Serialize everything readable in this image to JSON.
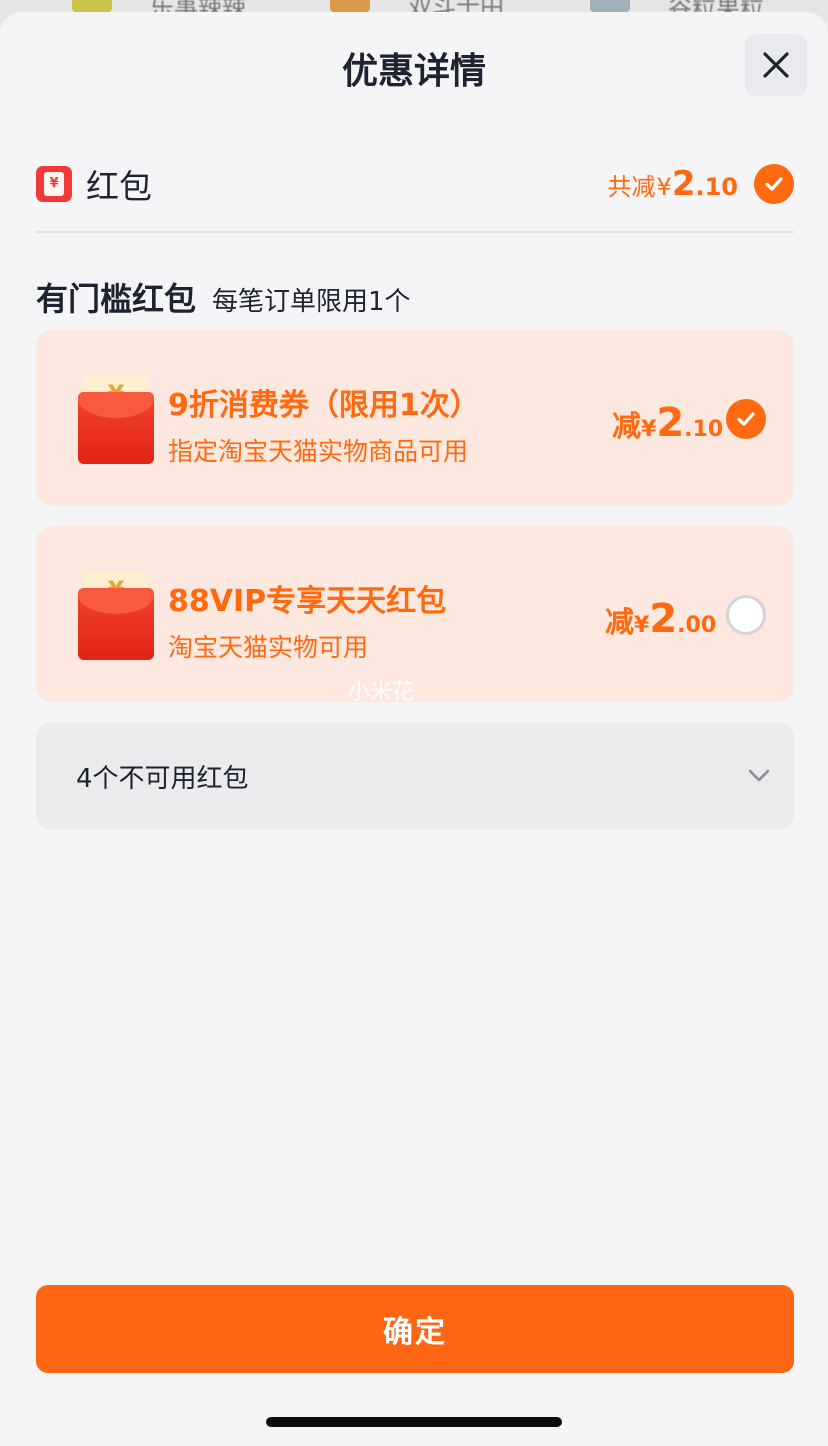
{
  "background": {
    "items": [
      "乐事辣辣",
      "双斗士田",
      "谷粒果粒"
    ]
  },
  "header": {
    "title": "优惠详情"
  },
  "red_packet": {
    "icon": "red-packet-icon",
    "label": "红包",
    "total_prefix": "共减",
    "currency": "¥",
    "total_int": "2",
    "total_dec": ".10",
    "selected": true
  },
  "section": {
    "title": "有门槛红包",
    "subtitle": "每笔订单限用1个"
  },
  "coupons": [
    {
      "title": "9折消费券（限用1次）",
      "desc": "指定淘宝天猫实物商品可用",
      "prefix": "减",
      "currency": "¥",
      "int": "2",
      "dec": ".10",
      "selected": true
    },
    {
      "title": "88VIP专享天天红包",
      "desc": "淘宝天猫实物可用",
      "prefix": "减",
      "currency": "¥",
      "int": "2",
      "dec": ".00",
      "selected": false
    }
  ],
  "watermark": "小米花",
  "unavailable": {
    "label": "4个不可用红包"
  },
  "confirm": {
    "label": "确定"
  },
  "colors": {
    "accent": "#ff6a10",
    "coupon_bg": "#fde8e0",
    "button": "#ff6613"
  }
}
